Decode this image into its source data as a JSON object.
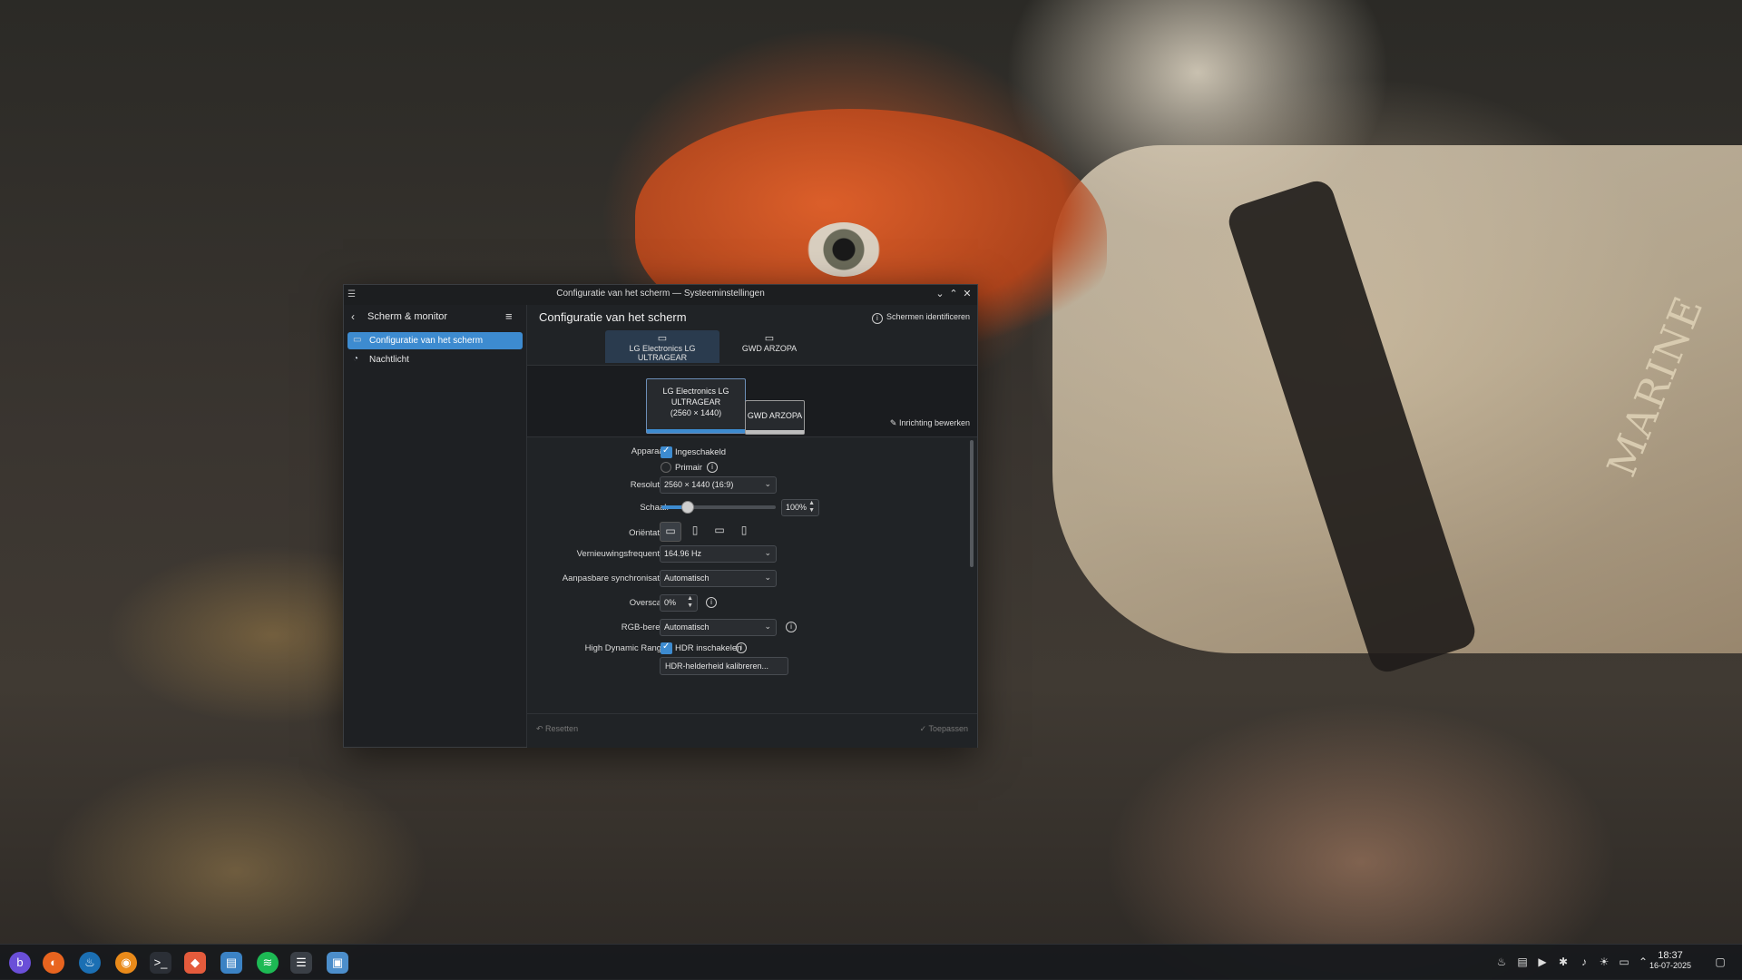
{
  "window": {
    "title": "Configuratie van het scherm — Systeeminstellingen",
    "minimize_icon": "⌄",
    "maximize_icon": "⌃",
    "close_icon": "✕"
  },
  "sidebar": {
    "back_label": "Scherm & monitor",
    "items": [
      {
        "label": "Configuratie van het scherm",
        "icon": "display-icon"
      },
      {
        "label": "Nachtlicht",
        "icon": "night-light-icon"
      }
    ]
  },
  "main": {
    "title": "Configuratie van het scherm",
    "identify_label": "Schermen identificeren",
    "tabs": [
      {
        "label": "LG Electronics LG ULTRAGEAR"
      },
      {
        "label": "GWD ARZOPA"
      }
    ],
    "layout": {
      "screen1_label": "LG Electronics LG ULTRAGEAR (2560 × 1440)",
      "screen1_line1": "LG Electronics LG",
      "screen1_line2": "ULTRAGEAR",
      "screen1_line3": "(2560 × 1440)",
      "screen2_label": "GWD ARZOPA",
      "edit_layout_label": "Inrichting bewerken"
    },
    "form": {
      "device_label": "Apparaat:",
      "enabled_label": "Ingeschakeld",
      "enabled_checked": true,
      "primary_label": "Primair",
      "primary_checked": false,
      "resolution_label": "Resolutie:",
      "resolution_value": "2560 × 1440 (16:9)",
      "scale_label": "Schaal:",
      "scale_value": "100%",
      "scale_level": 0.22,
      "orientation_label": "Oriëntatie:",
      "refresh_label": "Vernieuwingsfrequentie:",
      "refresh_value": "164.96 Hz",
      "adaptive_sync_label": "Aanpasbare synchronisatie:",
      "adaptive_sync_value": "Automatisch",
      "overscan_label": "Overscan:",
      "overscan_value": "0%",
      "rgb_label": "RGB-bereik:",
      "rgb_value": "Automatisch",
      "hdr_label": "High Dynamic Range:",
      "hdr_toggle_label": "HDR inschakelen",
      "hdr_checked": true,
      "hdr_calibrate_label": "HDR-helderheid kalibreren..."
    },
    "footer": {
      "reset_label": "Resetten",
      "apply_label": "Toepassen"
    }
  },
  "taskbar": {
    "apps": [
      "kde-launcher-icon",
      "firefox-icon",
      "steam-icon",
      "ubuntu-icon",
      "terminal-icon",
      "git-icon",
      "files-icon",
      "spotify-icon",
      "settings-icon",
      "display-settings-icon"
    ],
    "time": "18:37",
    "date": "16-07-2025"
  }
}
